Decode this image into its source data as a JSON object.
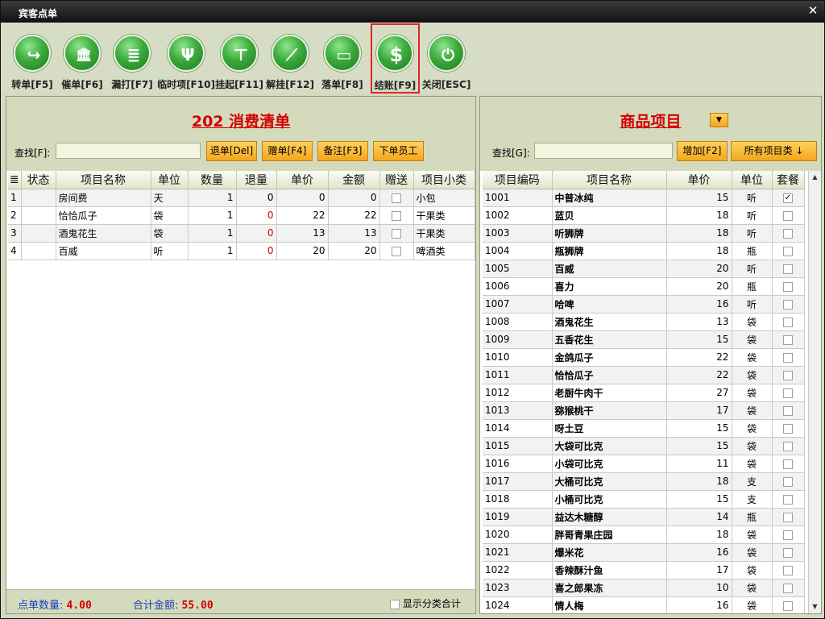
{
  "window": {
    "title": "宾客点单",
    "close": "✕"
  },
  "toolbar": [
    {
      "label": "转单[F5]",
      "icon": "↪"
    },
    {
      "label": "催单[F6]",
      "icon": "🏛"
    },
    {
      "label": "漏打[F7]",
      "icon": "≣"
    },
    {
      "label": "临时项[F10]",
      "icon": "Ψ"
    },
    {
      "label": "挂起[F11]",
      "icon": "⊤"
    },
    {
      "label": "解挂[F12]",
      "icon": "⟋"
    },
    {
      "label": "落单[F8]",
      "icon": "▭"
    },
    {
      "label": "结账[F9]",
      "icon": "$"
    },
    {
      "label": "关闭[ESC]",
      "icon": "⏻"
    }
  ],
  "left": {
    "title": "202 消费清单",
    "search_label": "查找[F]:",
    "search_value": "",
    "buttons": [
      "退单[Del]",
      "赠单[F4]",
      "备注[F3]",
      "下单员工"
    ],
    "columns": [
      "≣",
      "状态",
      "项目名称",
      "单位",
      "数量",
      "退量",
      "单价",
      "金额",
      "赠送",
      "项目小类"
    ],
    "rows": [
      {
        "idx": "1",
        "status": "",
        "name": "房间费",
        "unit": "天",
        "qty": "1",
        "ret": "0",
        "price": "0",
        "amount": "0",
        "gift": false,
        "cat": "小包"
      },
      {
        "idx": "2",
        "status": "",
        "name": "恰恰瓜子",
        "unit": "袋",
        "qty": "1",
        "ret": "0",
        "price": "22",
        "amount": "22",
        "gift": false,
        "cat": "干果类"
      },
      {
        "idx": "3",
        "status": "",
        "name": "酒鬼花生",
        "unit": "袋",
        "qty": "1",
        "ret": "0",
        "price": "13",
        "amount": "13",
        "gift": false,
        "cat": "干果类"
      },
      {
        "idx": "4",
        "status": "",
        "name": "百威",
        "unit": "听",
        "qty": "1",
        "ret": "0",
        "price": "20",
        "amount": "20",
        "gift": false,
        "cat": "啤酒类"
      }
    ],
    "footer": {
      "count_label": "点单数量:",
      "count_value": "4.00",
      "total_label": "合计金额:",
      "total_value": "55.00",
      "show_category_label": "显示分类合计"
    }
  },
  "right": {
    "title": "商品项目",
    "search_label": "查找[G]:",
    "search_value": "",
    "add_button": "增加[F2]",
    "category_button": "所有项目类 ↓",
    "columns": [
      "项目编码",
      "项目名称",
      "单价",
      "单位",
      "套餐"
    ],
    "rows": [
      {
        "code": "1001",
        "name": "中普冰纯",
        "price": "15",
        "unit": "听",
        "set": true
      },
      {
        "code": "1002",
        "name": "蓝贝",
        "price": "18",
        "unit": "听",
        "set": false
      },
      {
        "code": "1003",
        "name": "听狮牌",
        "price": "18",
        "unit": "听",
        "set": false
      },
      {
        "code": "1004",
        "name": "瓶狮牌",
        "price": "18",
        "unit": "瓶",
        "set": false
      },
      {
        "code": "1005",
        "name": "百威",
        "price": "20",
        "unit": "听",
        "set": false
      },
      {
        "code": "1006",
        "name": "喜力",
        "price": "20",
        "unit": "瓶",
        "set": false
      },
      {
        "code": "1007",
        "name": "哈啤",
        "price": "16",
        "unit": "听",
        "set": false
      },
      {
        "code": "1008",
        "name": "酒鬼花生",
        "price": "13",
        "unit": "袋",
        "set": false
      },
      {
        "code": "1009",
        "name": "五香花生",
        "price": "15",
        "unit": "袋",
        "set": false
      },
      {
        "code": "1010",
        "name": "金鸽瓜子",
        "price": "22",
        "unit": "袋",
        "set": false
      },
      {
        "code": "1011",
        "name": "恰恰瓜子",
        "price": "22",
        "unit": "袋",
        "set": false
      },
      {
        "code": "1012",
        "name": "老厨牛肉干",
        "price": "27",
        "unit": "袋",
        "set": false
      },
      {
        "code": "1013",
        "name": "猕猴桃干",
        "price": "17",
        "unit": "袋",
        "set": false
      },
      {
        "code": "1014",
        "name": "呀土豆",
        "price": "15",
        "unit": "袋",
        "set": false
      },
      {
        "code": "1015",
        "name": "大袋可比克",
        "price": "15",
        "unit": "袋",
        "set": false
      },
      {
        "code": "1016",
        "name": "小袋可比克",
        "price": "11",
        "unit": "袋",
        "set": false
      },
      {
        "code": "1017",
        "name": "大桶可比克",
        "price": "18",
        "unit": "支",
        "set": false
      },
      {
        "code": "1018",
        "name": "小桶可比克",
        "price": "15",
        "unit": "支",
        "set": false
      },
      {
        "code": "1019",
        "name": "益达木糖醇",
        "price": "14",
        "unit": "瓶",
        "set": false
      },
      {
        "code": "1020",
        "name": "胖哥青果庄园",
        "price": "18",
        "unit": "袋",
        "set": false
      },
      {
        "code": "1021",
        "name": "爆米花",
        "price": "16",
        "unit": "袋",
        "set": false
      },
      {
        "code": "1022",
        "name": "香辣酥汁鱼",
        "price": "17",
        "unit": "袋",
        "set": false
      },
      {
        "code": "1023",
        "name": "喜之郎果冻",
        "price": "10",
        "unit": "袋",
        "set": false
      },
      {
        "code": "1024",
        "name": "情人梅",
        "price": "16",
        "unit": "袋",
        "set": false
      }
    ]
  },
  "colors": {
    "accent_red": "#d40000",
    "orange_button": "#f3a61c",
    "green_icon": "#3cab3c",
    "label_blue": "#1a3fbf"
  }
}
